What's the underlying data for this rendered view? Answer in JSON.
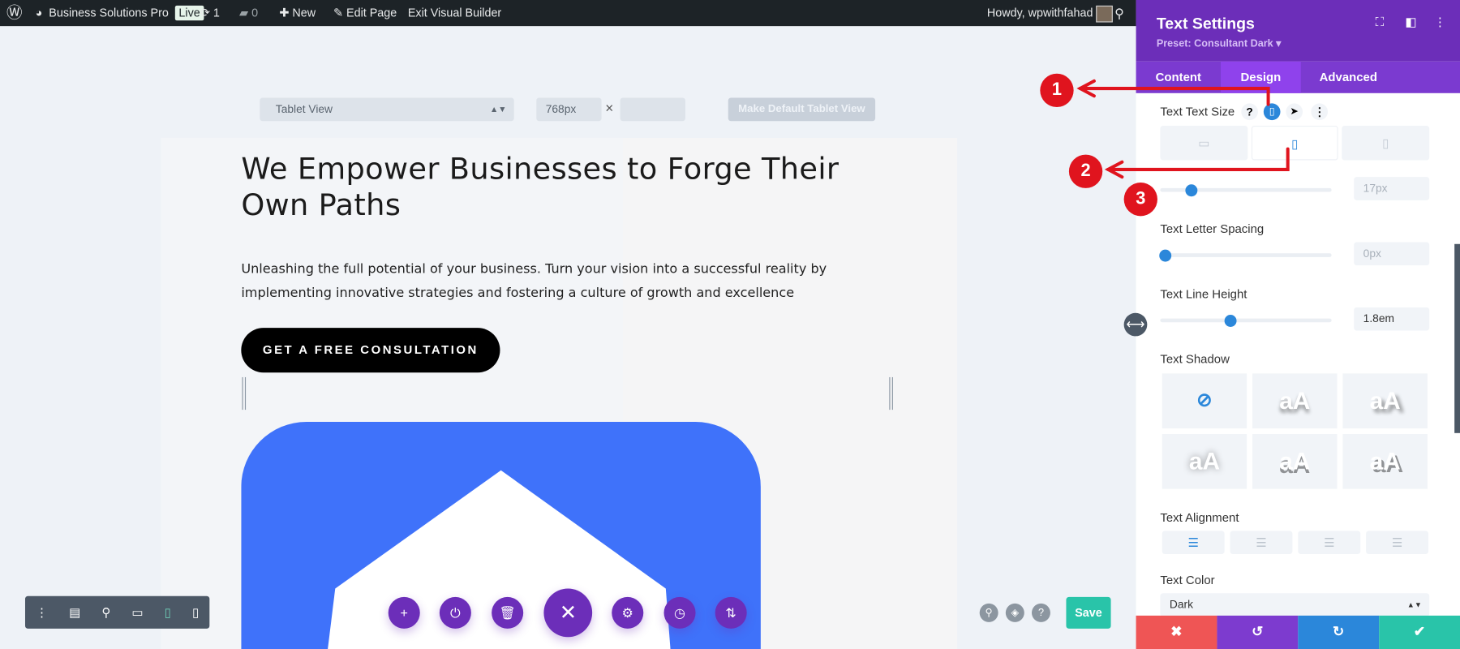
{
  "admin_bar": {
    "site_name": "Business Solutions Pro",
    "live_badge": "Live",
    "updates_count": "1",
    "comments_count": "0",
    "new_label": "New",
    "edit_page_label": "Edit Page",
    "exit_label": "Exit Visual Builder",
    "howdy": "Howdy, wpwithfahad"
  },
  "view_toolbar": {
    "view_select": "Tablet View",
    "width_value": "768px",
    "times": "×",
    "height_value": "",
    "make_default_label": "Make Default Tablet View"
  },
  "page": {
    "heading": "We Empower Businesses to Forge Their Own Paths",
    "paragraph": "Unleashing the full potential of your business. Turn your vision into a successful reality by implementing innovative strategies and fostering a culture of growth and excellence",
    "cta_label": "GET A FREE CONSULTATION",
    "image_color": "#3f72fa"
  },
  "builder": {
    "save_label": "Save",
    "help": "?"
  },
  "panel": {
    "title": "Text Settings",
    "preset": "Preset: Consultant Dark ▾",
    "tabs": [
      {
        "label": "Content"
      },
      {
        "label": "Design",
        "active": true
      },
      {
        "label": "Advanced"
      }
    ],
    "text_size": {
      "label": "Text Text Size",
      "help": "?",
      "active_device": "tablet",
      "value": "17px",
      "slider_percent": 18
    },
    "letter_spacing": {
      "label": "Text Letter Spacing",
      "value": "0px",
      "slider_percent": 3
    },
    "line_height": {
      "label": "Text Line Height",
      "value": "1.8em",
      "slider_percent": 41
    },
    "text_shadow": {
      "label": "Text Shadow",
      "sample": "aA",
      "selected": "none"
    },
    "text_alignment": {
      "label": "Text Alignment",
      "selected": "left"
    },
    "text_color": {
      "label": "Text Color",
      "value": "Dark"
    },
    "footer_colors": {
      "cancel": "#ef5555",
      "undo": "#7d3bcf",
      "redo": "#2b87da",
      "save": "#29c4a9"
    }
  },
  "annotations": [
    "1",
    "2",
    "3"
  ],
  "colors": {
    "accent_purple": "#6c2eb9",
    "annotation_red": "#e0141e",
    "admin_bar": "#1d2327"
  }
}
